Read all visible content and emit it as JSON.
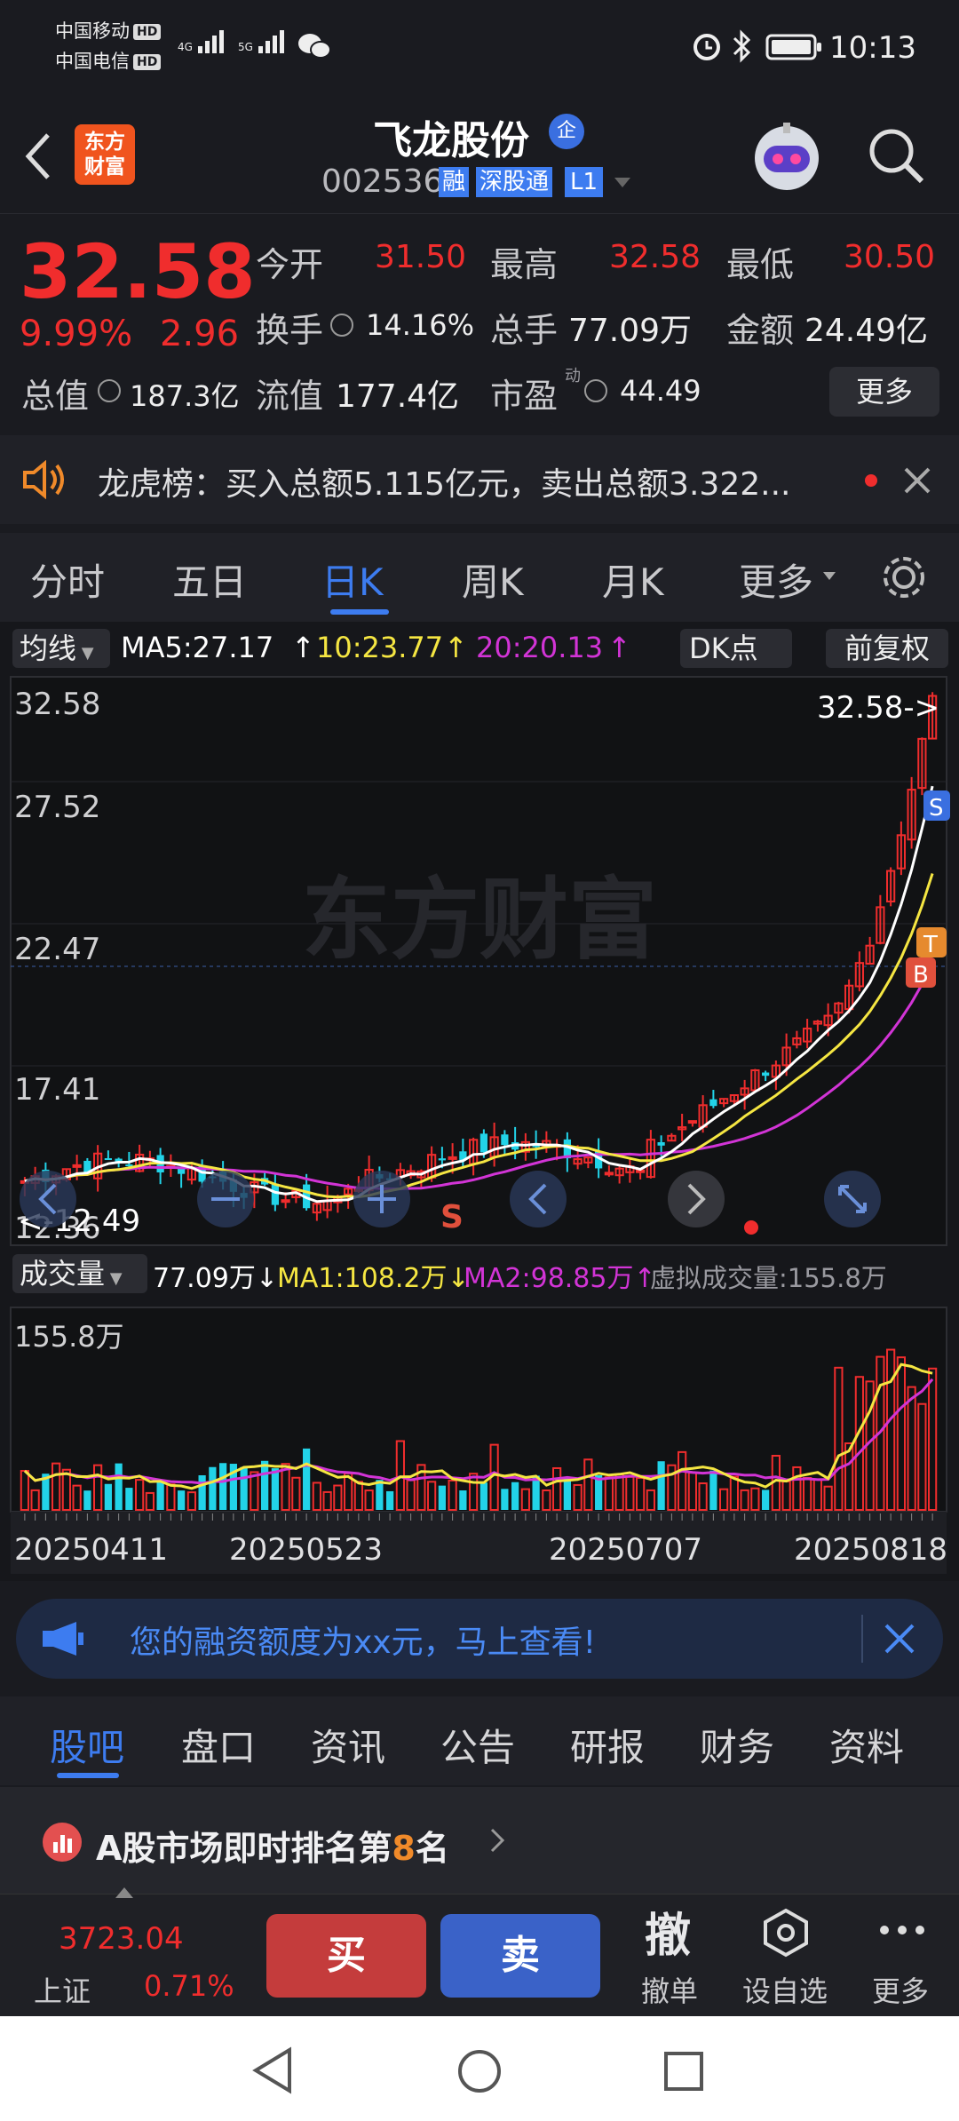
{
  "status": {
    "carrier1": "中国移动",
    "carrier2": "中国电信",
    "hd": "HD",
    "net1": "4G",
    "net2": "5G",
    "time": "10:13"
  },
  "header": {
    "logo_line1": "东方",
    "logo_line2": "财富",
    "stock_name": "飞龙股份",
    "code": "002536",
    "tag_rong": "融",
    "tag_sgt": "深股通",
    "tag_level": "L1",
    "badge": "企"
  },
  "quote": {
    "price": "32.58",
    "pct": "9.99%",
    "change": "2.96",
    "open_label": "今开",
    "open": "31.50",
    "high_label": "最高",
    "high": "32.58",
    "low_label": "最低",
    "low": "30.50",
    "turnover_label": "换手",
    "turnover": "14.16%",
    "volume_label": "总手",
    "volume": "77.09万",
    "amount_label": "金额",
    "amount": "24.49亿",
    "mcap_label": "总值",
    "mcap": "187.3亿",
    "float_label": "流值",
    "float": "177.4亿",
    "pe_label": "市盈",
    "pe_sup": "动",
    "pe": "44.49",
    "more": "更多"
  },
  "notice": {
    "text": "龙虎榜：买入总额5.115亿元，卖出总额3.322..."
  },
  "period_tabs": [
    {
      "label": "分时",
      "active": false
    },
    {
      "label": "五日",
      "active": false
    },
    {
      "label": "日K",
      "active": true
    },
    {
      "label": "周K",
      "active": false
    },
    {
      "label": "月K",
      "active": false
    },
    {
      "label": "更多",
      "active": false
    }
  ],
  "kline": {
    "indicator": "均线",
    "ma5": "MA5:27.17",
    "ma10": "10:23.77",
    "ma20": "20:20.13",
    "dk": "DK点",
    "adjust": "前复权",
    "watermark": "东方财富",
    "y_labels": [
      "32.58",
      "27.52",
      "22.47",
      "17.41",
      "12.36"
    ],
    "last_price_label": "32.58->",
    "low_mark_label": "<-12.49",
    "markers": {
      "s": "S",
      "t": "T",
      "b": "B"
    }
  },
  "volume": {
    "indicator": "成交量",
    "vol": "77.09万",
    "ma1": "MA1:108.2万",
    "ma2": "MA2:98.85万",
    "virtual": "虚拟成交量:155.8万",
    "max_label": "155.8万",
    "dates": [
      "20250411",
      "20250523",
      "20250707",
      "20250818"
    ]
  },
  "banner": {
    "text": "您的融资额度为xx元，马上查看!"
  },
  "info_tabs": [
    {
      "label": "股吧",
      "active": true
    },
    {
      "label": "盘口",
      "active": false
    },
    {
      "label": "资讯",
      "active": false
    },
    {
      "label": "公告",
      "active": false
    },
    {
      "label": "研报",
      "active": false
    },
    {
      "label": "财务",
      "active": false
    },
    {
      "label": "资料",
      "active": false
    }
  ],
  "rank": {
    "prefix": "A股市场即时排名第",
    "num": "8",
    "suffix": "名"
  },
  "tradebar": {
    "index_value": "3723.04",
    "index_name": "上证",
    "index_pct": "0.71%",
    "buy": "买",
    "sell": "卖",
    "cancel_icon": "撤",
    "cancel": "撤单",
    "watch": "设自选",
    "more": "更多"
  },
  "colors": {
    "up": "#f02d2d",
    "down": "#22d3e8",
    "ma5": "#ffffff",
    "ma10": "#f5e642",
    "ma20": "#d234d6",
    "accent": "#3d7cf0"
  }
}
